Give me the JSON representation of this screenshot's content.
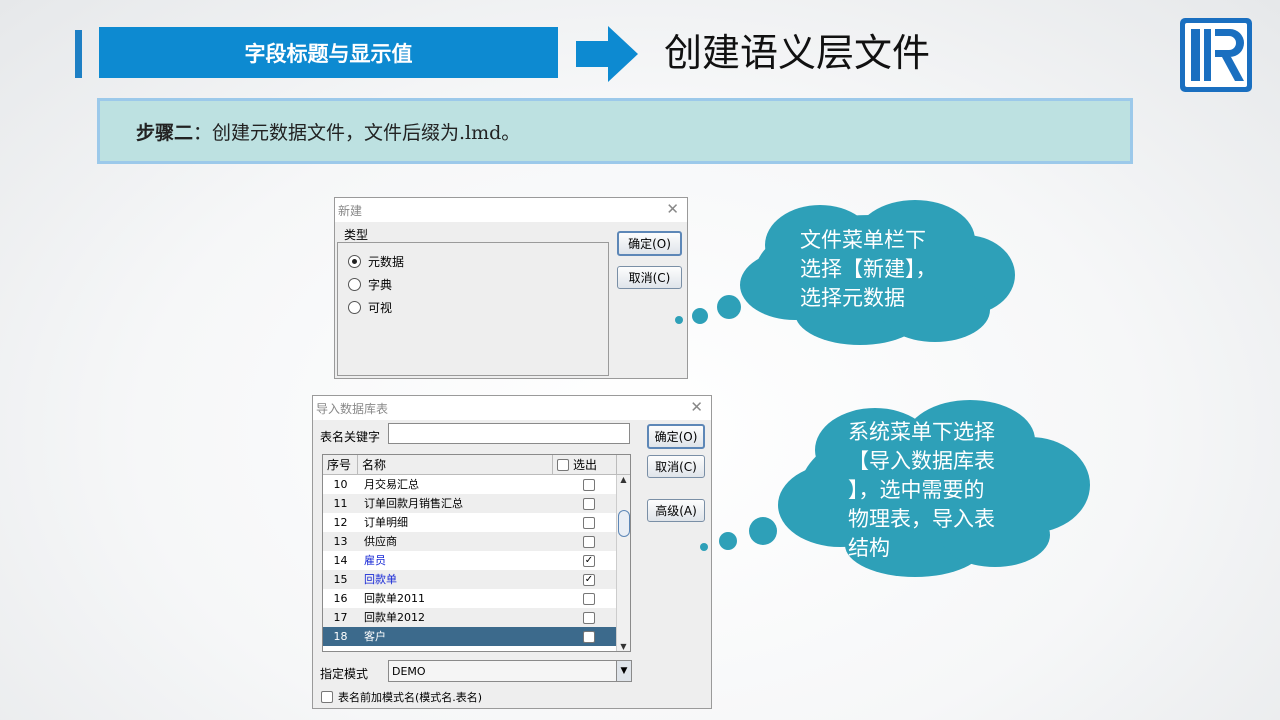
{
  "header": {
    "section_label": "字段标题与显示值",
    "title": "创建语义层文件"
  },
  "step": {
    "label": "步骤二",
    "text": "：创建元数据文件，文件后缀为.lmd。"
  },
  "new_dialog": {
    "title": "新建",
    "group_label": "类型",
    "options": [
      "元数据",
      "字典",
      "可视"
    ],
    "selected": "元数据",
    "ok_label": "确定(O)",
    "cancel_label": "取消(C)"
  },
  "import_dialog": {
    "title": "导入数据库表",
    "keyword_label": "表名关键字",
    "keyword_value": "",
    "columns": [
      "序号",
      "名称",
      "选出"
    ],
    "rows": [
      {
        "no": "10",
        "name": "月交易汇总",
        "checked": false
      },
      {
        "no": "11",
        "name": "订单回款月销售汇总",
        "checked": false
      },
      {
        "no": "12",
        "name": "订单明细",
        "checked": false
      },
      {
        "no": "13",
        "name": "供应商",
        "checked": false
      },
      {
        "no": "14",
        "name": "雇员",
        "checked": true
      },
      {
        "no": "15",
        "name": "回款单",
        "checked": true
      },
      {
        "no": "16",
        "name": "回款单2011",
        "checked": false
      },
      {
        "no": "17",
        "name": "回款单2012",
        "checked": false
      },
      {
        "no": "18",
        "name": "客户",
        "checked": false
      }
    ],
    "ok_label": "确定(O)",
    "cancel_label": "取消(C)",
    "advanced_label": "高级(A)",
    "schema_label": "指定模式",
    "schema_value": "DEMO",
    "prefix_label": "表名前加模式名(模式名.表名)"
  },
  "callouts": {
    "top": [
      "文件菜单栏下",
      "选择【新建】，",
      "选择元数据"
    ],
    "bottom": [
      "系统菜单下选择",
      "【导入数据库表",
      "】，选中需要的",
      "物理表，导入表",
      "结构"
    ]
  },
  "colors": {
    "accent": "#0d8ad1",
    "cloud": "#2ea0b8",
    "step_bg": "#bde1e1",
    "selected_row": "#3c6a8c"
  }
}
